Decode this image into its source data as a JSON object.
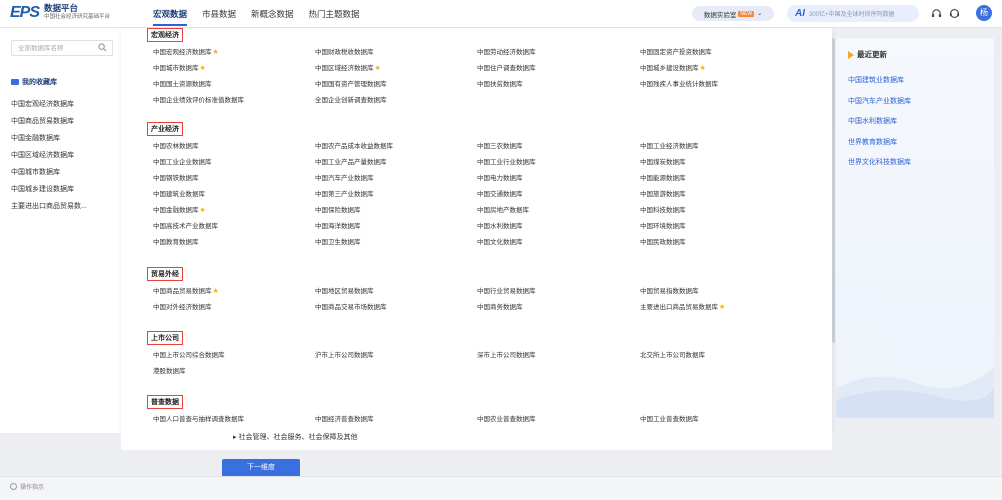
{
  "header": {
    "logo_mark": "EPS",
    "logo_title": "数据平台",
    "logo_subtitle": "中国社会经济研究基础平台",
    "nav": [
      "宏观数据",
      "市县数据",
      "新概念数据",
      "热门主题数据"
    ],
    "lab_label": "数据实验室",
    "lab_badge": "NEW",
    "ai_label": "AI",
    "ai_placeholder": "300亿+中国及全球时间序列数据",
    "avatar": "杨"
  },
  "sidebar": {
    "search_placeholder": "全部数据库名称",
    "fav_title": "我的收藏库",
    "fav_items": [
      "中国宏观经济数据库",
      "中国商品贸易数据库",
      "中国金融数据库",
      "中国区域经济数据库",
      "中国城市数据库",
      "中国城乡建设数据库",
      "主要进出口商品贸易数..."
    ]
  },
  "categories": [
    {
      "title": "宏观经济",
      "items": [
        {
          "name": "中国宏观经济数据库",
          "star": true
        },
        {
          "name": "中国财政税收数据库",
          "star": false
        },
        {
          "name": "中国劳动经济数据库",
          "star": false
        },
        {
          "name": "中国固定资产投资数据库",
          "star": false
        },
        {
          "name": "中国城市数据库",
          "star": true
        },
        {
          "name": "中国区域经济数据库",
          "star": true
        },
        {
          "name": "中国住户调查数据库",
          "star": false
        },
        {
          "name": "中国城乡建设数据库",
          "star": true
        },
        {
          "name": "中国国土资源数据库",
          "star": false
        },
        {
          "name": "中国国有资产管理数据库",
          "star": false
        },
        {
          "name": "中国扶贫数据库",
          "star": false
        },
        {
          "name": "中国残疾人事业统计数据库",
          "star": false
        },
        {
          "name": "中国企业绩效评价标准值数据库",
          "star": false
        },
        {
          "name": "全国企业创新调查数据库",
          "star": false
        }
      ]
    },
    {
      "title": "产业经济",
      "items": [
        {
          "name": "中国农林数据库",
          "star": false
        },
        {
          "name": "中国农产品成本收益数据库",
          "star": false
        },
        {
          "name": "中国三农数据库",
          "star": false
        },
        {
          "name": "中国工业经济数据库",
          "star": false
        },
        {
          "name": "中国工业企业数据库",
          "star": false
        },
        {
          "name": "中国工业产品产量数据库",
          "star": false
        },
        {
          "name": "中国工业行业数据库",
          "star": false
        },
        {
          "name": "中国煤炭数据库",
          "star": false
        },
        {
          "name": "中国钢铁数据库",
          "star": false
        },
        {
          "name": "中国汽车产业数据库",
          "star": false
        },
        {
          "name": "中国电力数据库",
          "star": false
        },
        {
          "name": "中国能源数据库",
          "star": false
        },
        {
          "name": "中国建筑业数据库",
          "star": false
        },
        {
          "name": "中国第三产业数据库",
          "star": false
        },
        {
          "name": "中国交通数据库",
          "star": false
        },
        {
          "name": "中国旅游数据库",
          "star": false
        },
        {
          "name": "中国金融数据库",
          "star": true
        },
        {
          "name": "中国保险数据库",
          "star": false
        },
        {
          "name": "中国房地产数据库",
          "star": false
        },
        {
          "name": "中国科技数据库",
          "star": false
        },
        {
          "name": "中国高技术产业数据库",
          "star": false
        },
        {
          "name": "中国海洋数据库",
          "star": false
        },
        {
          "name": "中国水利数据库",
          "star": false
        },
        {
          "name": "中国环境数据库",
          "star": false
        },
        {
          "name": "中国教育数据库",
          "star": false
        },
        {
          "name": "中国卫生数据库",
          "star": false
        },
        {
          "name": "中国文化数据库",
          "star": false
        },
        {
          "name": "中国民政数据库",
          "star": false
        }
      ]
    },
    {
      "title": "贸易外经",
      "items": [
        {
          "name": "中国商品贸易数据库",
          "star": true
        },
        {
          "name": "中国地区贸易数据库",
          "star": false
        },
        {
          "name": "中国行业贸易数据库",
          "star": false
        },
        {
          "name": "中国贸易指数数据库",
          "star": false
        },
        {
          "name": "中国对外经济数据库",
          "star": false
        },
        {
          "name": "中国商品交易市场数据库",
          "star": false
        },
        {
          "name": "中国商务数据库",
          "star": false
        },
        {
          "name": "主要进出口商品贸易数据库",
          "star": true
        }
      ]
    },
    {
      "title": "上市公司",
      "items": [
        {
          "name": "中国上市公司综合数据库",
          "star": false
        },
        {
          "name": "沪市上市公司数据库",
          "star": false
        },
        {
          "name": "深市上市公司数据库",
          "star": false
        },
        {
          "name": "北交所上市公司数据库",
          "star": false
        },
        {
          "name": "港股数据库",
          "star": false
        }
      ]
    },
    {
      "title": "普查数据",
      "items": [
        {
          "name": "中国人口普查与抽样调查数据库",
          "star": false
        },
        {
          "name": "中国经济普查数据库",
          "star": false
        },
        {
          "name": "中国农业普查数据库",
          "star": false
        },
        {
          "name": "中国工业普查数据库",
          "star": false
        }
      ]
    }
  ],
  "recent": {
    "title": "最近更新",
    "items": [
      "中国建筑业数据库",
      "中国汽车产业数据库",
      "中国水利数据库",
      "世界教育数据库",
      "世界文化科技数据库"
    ]
  },
  "lower": {
    "text": "▸ 社会管理、社会服务、社会保障及其他",
    "next_button": "下一维度"
  },
  "footer": {
    "text": "操作指示"
  }
}
